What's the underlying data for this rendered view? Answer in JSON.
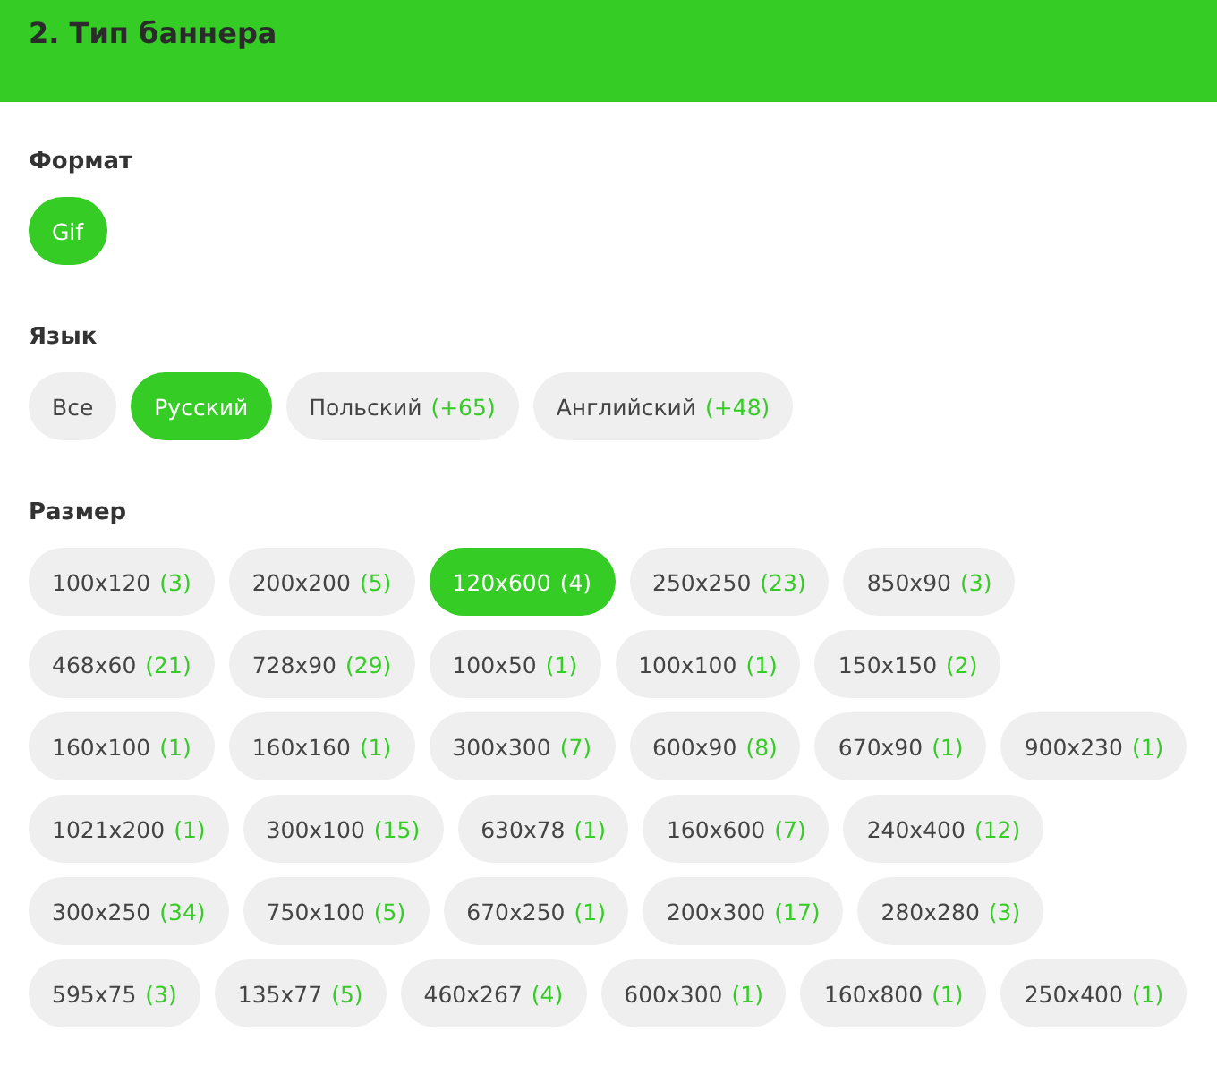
{
  "header": {
    "title": "2. Тип баннера"
  },
  "sections": [
    {
      "title": "Формат",
      "rows": [
        [
          {
            "label": "Gif",
            "selected": true
          }
        ]
      ]
    },
    {
      "title": "Язык",
      "rows": [
        [
          {
            "label": "Все",
            "selected": false
          },
          {
            "label": "Русский",
            "selected": true
          },
          {
            "label": "Польский",
            "count": "(+65)",
            "selected": false
          },
          {
            "label": "Английский",
            "count": "(+48)",
            "selected": false
          }
        ]
      ]
    },
    {
      "title": "Размер",
      "rows": [
        [
          {
            "label": "100x120",
            "count": "(3)",
            "selected": false
          },
          {
            "label": "200x200",
            "count": "(5)",
            "selected": false
          },
          {
            "label": "120x600",
            "count": "(4)",
            "selected": true
          },
          {
            "label": "250x250",
            "count": "(23)",
            "selected": false
          },
          {
            "label": "850x90",
            "count": "(3)",
            "selected": false
          }
        ],
        [
          {
            "label": "468x60",
            "count": "(21)",
            "selected": false
          },
          {
            "label": "728x90",
            "count": "(29)",
            "selected": false
          },
          {
            "label": "100x50",
            "count": "(1)",
            "selected": false
          },
          {
            "label": "100x100",
            "count": "(1)",
            "selected": false
          },
          {
            "label": "150x150",
            "count": "(2)",
            "selected": false
          }
        ],
        [
          {
            "label": "160x100",
            "count": "(1)",
            "selected": false
          },
          {
            "label": "160x160",
            "count": "(1)",
            "selected": false
          },
          {
            "label": "300x300",
            "count": "(7)",
            "selected": false
          },
          {
            "label": "600x90",
            "count": "(8)",
            "selected": false
          },
          {
            "label": "670x90",
            "count": "(1)",
            "selected": false
          },
          {
            "label": "900x230",
            "count": "(1)",
            "selected": false
          }
        ],
        [
          {
            "label": "1021x200",
            "count": "(1)",
            "selected": false
          },
          {
            "label": "300x100",
            "count": "(15)",
            "selected": false
          },
          {
            "label": "630x78",
            "count": "(1)",
            "selected": false
          },
          {
            "label": "160x600",
            "count": "(7)",
            "selected": false
          },
          {
            "label": "240x400",
            "count": "(12)",
            "selected": false
          }
        ],
        [
          {
            "label": "300x250",
            "count": "(34)",
            "selected": false
          },
          {
            "label": "750x100",
            "count": "(5)",
            "selected": false
          },
          {
            "label": "670x250",
            "count": "(1)",
            "selected": false
          },
          {
            "label": "200x300",
            "count": "(17)",
            "selected": false
          },
          {
            "label": "280x280",
            "count": "(3)",
            "selected": false
          }
        ],
        [
          {
            "label": "595x75",
            "count": "(3)",
            "selected": false
          },
          {
            "label": "135x77",
            "count": "(5)",
            "selected": false
          },
          {
            "label": "460x267",
            "count": "(4)",
            "selected": false
          },
          {
            "label": "600x300",
            "count": "(1)",
            "selected": false
          },
          {
            "label": "160x800",
            "count": "(1)",
            "selected": false
          },
          {
            "label": "250x400",
            "count": "(1)",
            "selected": false
          }
        ]
      ]
    }
  ]
}
